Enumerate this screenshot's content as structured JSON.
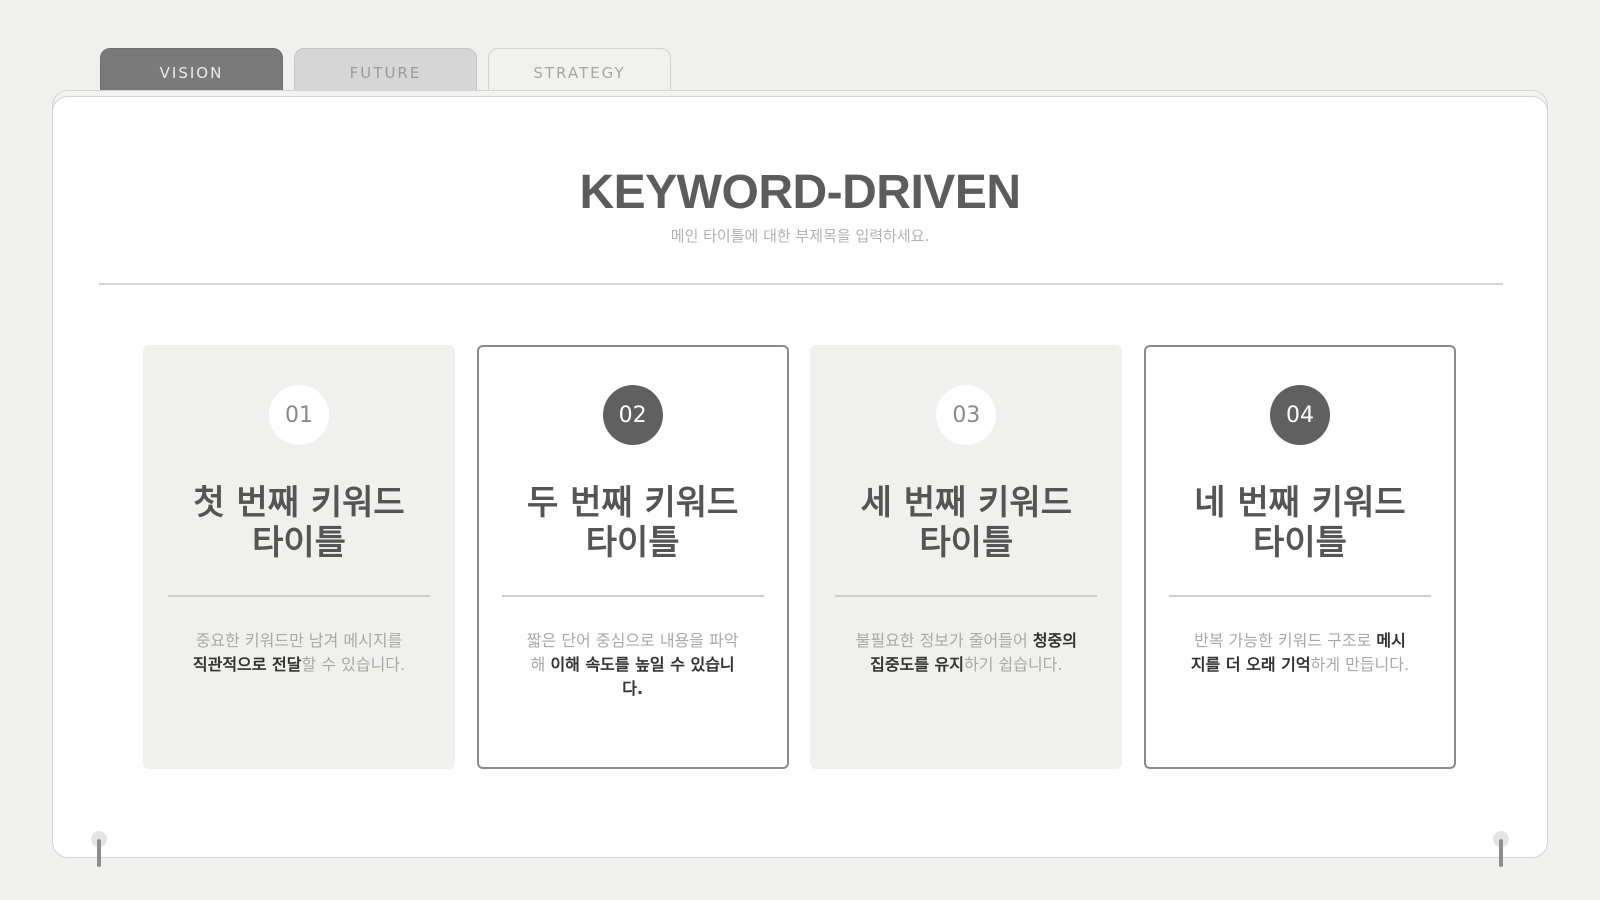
{
  "tabs": [
    {
      "label": "VISION"
    },
    {
      "label": "FUTURE"
    },
    {
      "label": "STRATEGY"
    }
  ],
  "header": {
    "title": "KEYWORD-DRIVEN",
    "subtitle": "메인 타이틀에 대한 부제목을 입력하세요."
  },
  "cards": [
    {
      "number": "01",
      "title_line1": "첫 번째 키워드",
      "title_line2": "타이틀",
      "desc_pre": "중요한 키워드만 남겨 메시지를 ",
      "desc_bold": "직관적으로 전달",
      "desc_post": "할 수 있습니다."
    },
    {
      "number": "02",
      "title_line1": "두 번째 키워드",
      "title_line2": "타이틀",
      "desc_pre": "짧은 단어 중심으로 내용을 파악해 ",
      "desc_bold": "이해 속도를 높일 수 있습니다.",
      "desc_post": ""
    },
    {
      "number": "03",
      "title_line1": "세 번째 키워드",
      "title_line2": "타이틀",
      "desc_pre": "불필요한 정보가 줄어들어 ",
      "desc_bold": "청중의 집중도를 유지",
      "desc_post": "하기 쉽습니다."
    },
    {
      "number": "04",
      "title_line1": "네 번째 키워드",
      "title_line2": "타이틀",
      "desc_pre": "반복 가능한 키워드 구조로 ",
      "desc_bold": "메시지를 더 오래 기억",
      "desc_post": "하게 만듭니다."
    }
  ]
}
